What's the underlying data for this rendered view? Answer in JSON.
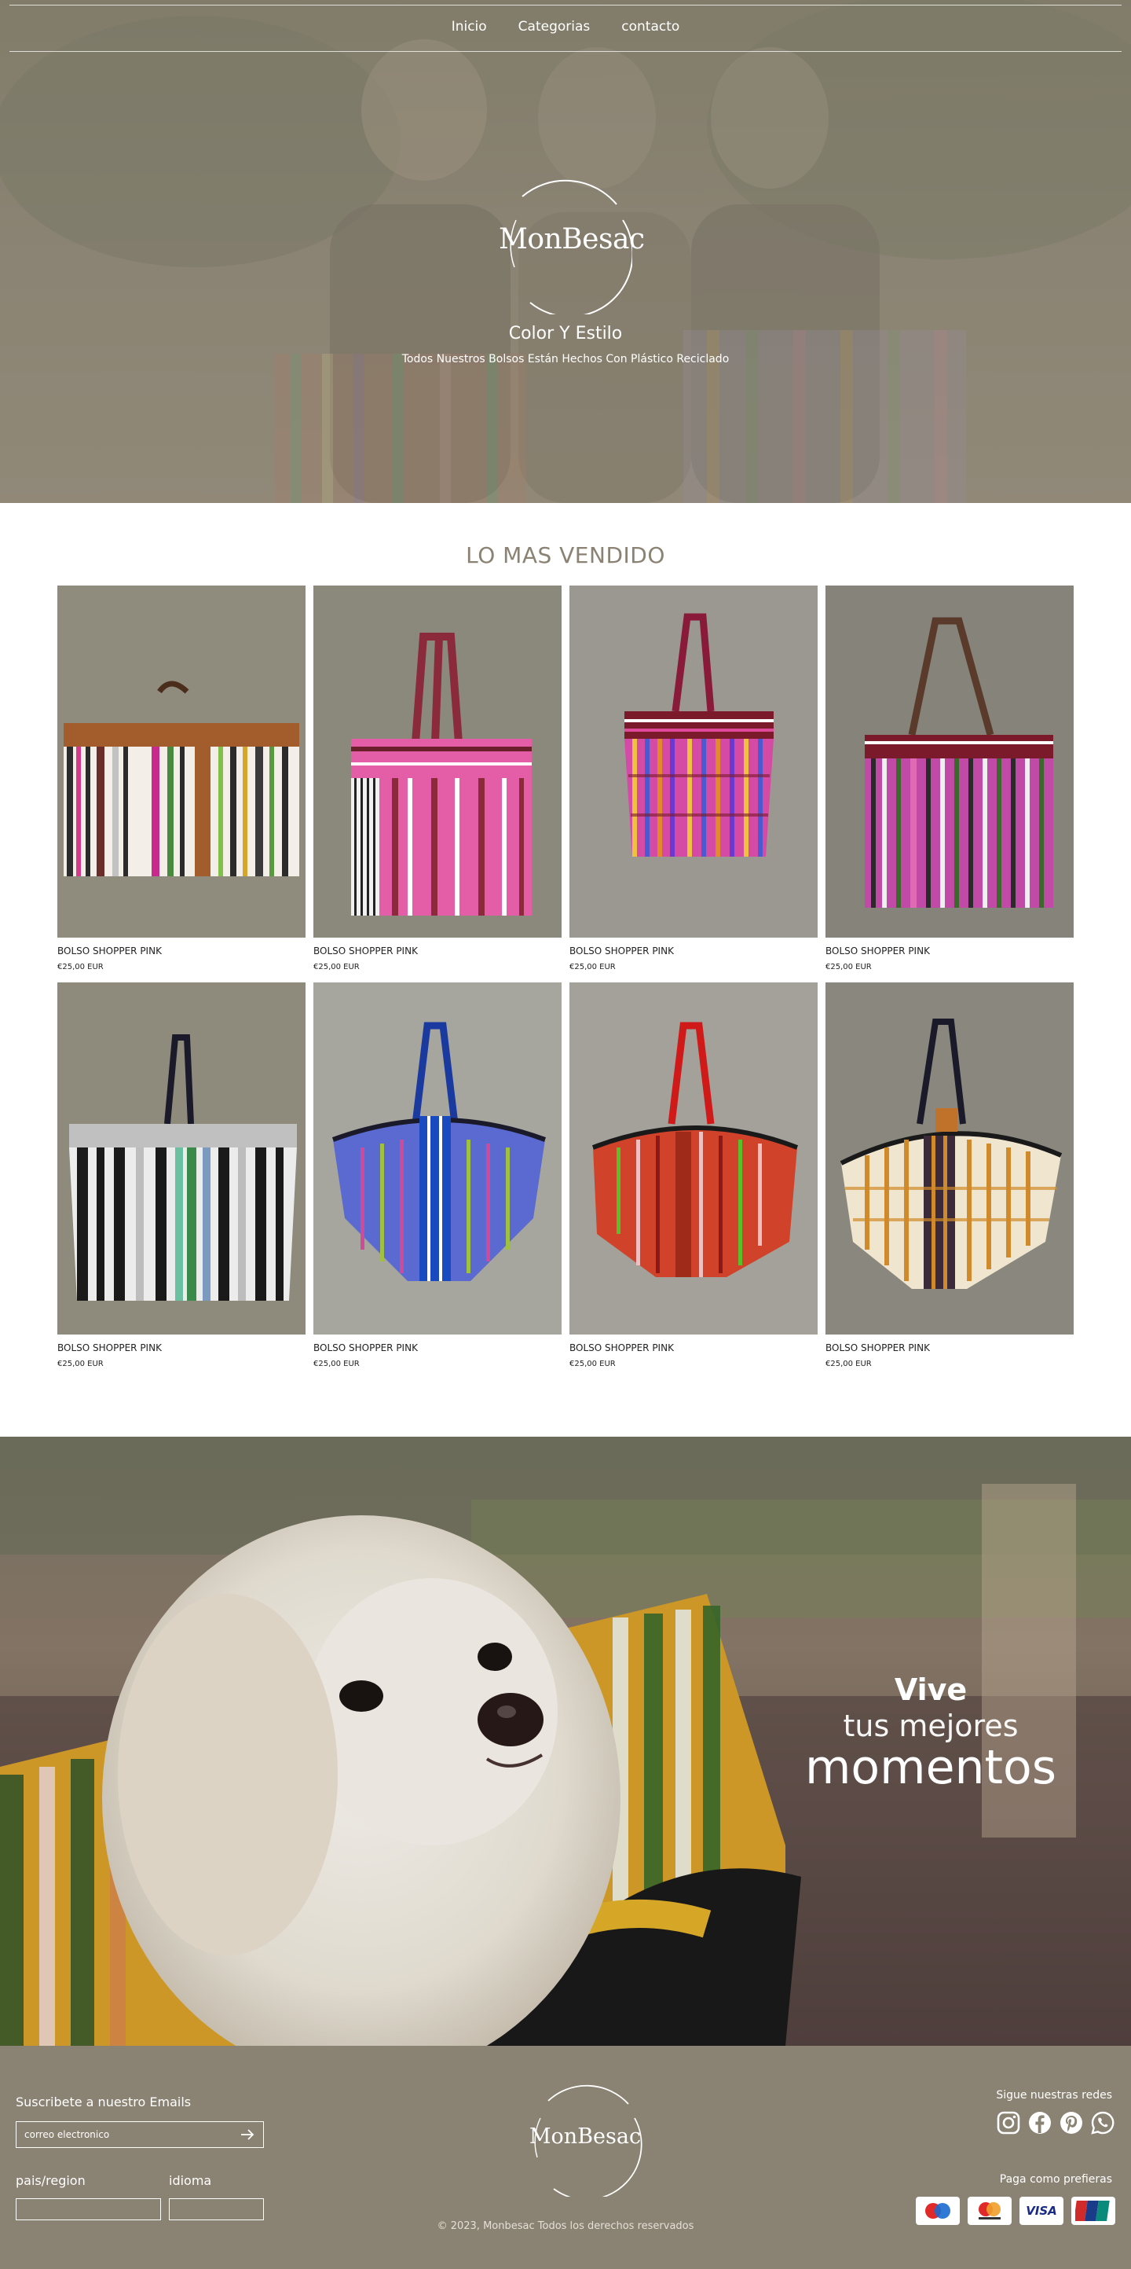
{
  "nav": {
    "items": [
      "Inicio",
      "Categorias",
      "contacto"
    ]
  },
  "hero": {
    "brand": "MonBesac",
    "tagline": "Color Y Estilo",
    "subtagline": "Todos Nuestros Bolsos Están Hechos Con Plástico Reciclado"
  },
  "bestsellers": {
    "title": "LO MAS VENDIDO",
    "products": [
      {
        "name": "BOLSO SHOPPER PINK",
        "price": "€25,00 EUR"
      },
      {
        "name": "BOLSO SHOPPER PINK",
        "price": "€25,00 EUR"
      },
      {
        "name": "BOLSO SHOPPER PINK",
        "price": "€25,00 EUR"
      },
      {
        "name": "BOLSO SHOPPER PINK",
        "price": "€25,00 EUR"
      },
      {
        "name": "BOLSO SHOPPER PINK",
        "price": "€25,00 EUR"
      },
      {
        "name": "BOLSO SHOPPER PINK",
        "price": "€25,00 EUR"
      },
      {
        "name": "BOLSO SHOPPER PINK",
        "price": "€25,00 EUR"
      },
      {
        "name": "BOLSO SHOPPER PINK",
        "price": "€25,00 EUR"
      }
    ]
  },
  "banner": {
    "line1": "Vive",
    "line2": "tus mejores",
    "line3": "momentos"
  },
  "footer": {
    "subscribe_label": "Suscribete a nuestro Emails",
    "email_placeholder": "correo electronico",
    "country_label": "pais/region",
    "language_label": "idioma",
    "brand": "MonBesac",
    "copyright": "© 2023, Monbesac Todos los derechos reservados",
    "social_label": "Sigue nuestras redes",
    "social_icons": [
      "instagram-icon",
      "facebook-icon",
      "pinterest-icon",
      "whatsapp-icon"
    ],
    "payment_label": "Paga como prefieras",
    "payments": [
      "maestro",
      "mastercard",
      "VISA",
      "UnionPay"
    ]
  },
  "colors": {
    "brand": "#8a8272",
    "white": "#ffffff"
  }
}
